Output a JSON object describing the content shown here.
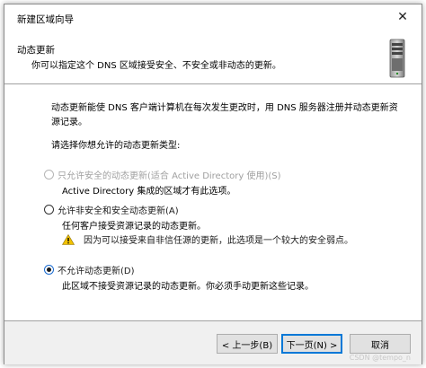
{
  "window": {
    "title": "新建区域向导",
    "close_symbol": "✕"
  },
  "header": {
    "title": "动态更新",
    "subtitle": "你可以指定这个 DNS 区域接受安全、不安全或非动态的更新。",
    "icon": "server-icon"
  },
  "content": {
    "description": "动态更新能使 DNS 客户端计算机在每次发生更改时，用 DNS 服务器注册并动态更新资源记录。",
    "prompt": "请选择你想允许的动态更新类型:",
    "options": [
      {
        "label": "只允许安全的动态更新(适合 Active Directory 使用)(S)",
        "note": "Active Directory 集成的区域才有此选项。",
        "selected": false,
        "enabled": false
      },
      {
        "label": "允许非安全和安全动态更新(A)",
        "note": "任何客户接受资源记录的动态更新。",
        "warning": "因为可以接受来自非信任源的更新，此选项是一个较大的安全弱点。",
        "selected": false,
        "enabled": true
      },
      {
        "label": "不允许动态更新(D)",
        "note": "此区域不接受资源记录的动态更新。你必须手动更新这些记录。",
        "selected": true,
        "enabled": true
      }
    ]
  },
  "footer": {
    "back_label": "< 上一步(B)",
    "next_label": "下一页(N) >",
    "cancel_label": "取消"
  },
  "watermark": "CSDN @tempo_n",
  "colors": {
    "accent": "#0078d7",
    "warning": "#f2c200",
    "footer_bg": "#f0f0f0"
  }
}
